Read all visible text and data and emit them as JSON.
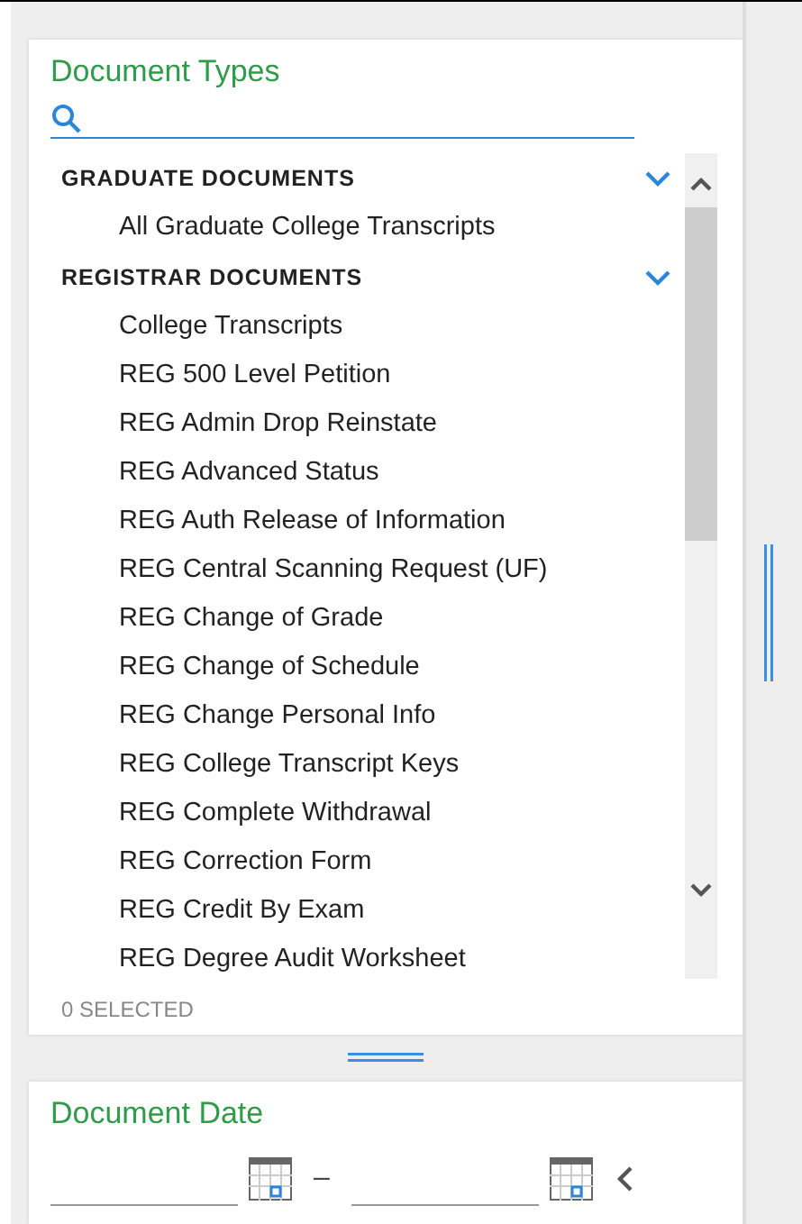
{
  "document_types": {
    "title": "Document Types",
    "groups": [
      {
        "label": "GRADUATE DOCUMENTS",
        "expanded": true,
        "items": [
          "All Graduate College Transcripts"
        ]
      },
      {
        "label": "REGISTRAR DOCUMENTS",
        "expanded": true,
        "items": [
          "College Transcripts",
          "REG 500 Level Petition",
          "REG Admin Drop Reinstate",
          "REG Advanced Status",
          "REG Auth Release of Information",
          "REG Central Scanning Request (UF)",
          "REG Change of Grade",
          "REG Change of Schedule",
          "REG Change Personal Info",
          "REG College Transcript Keys",
          "REG Complete Withdrawal",
          "REG Correction Form",
          "REG Credit By Exam",
          "REG Degree Audit Worksheet"
        ]
      }
    ],
    "selected_count": "0 SELECTED"
  },
  "document_date": {
    "title": "Document Date",
    "separator": "–"
  }
}
